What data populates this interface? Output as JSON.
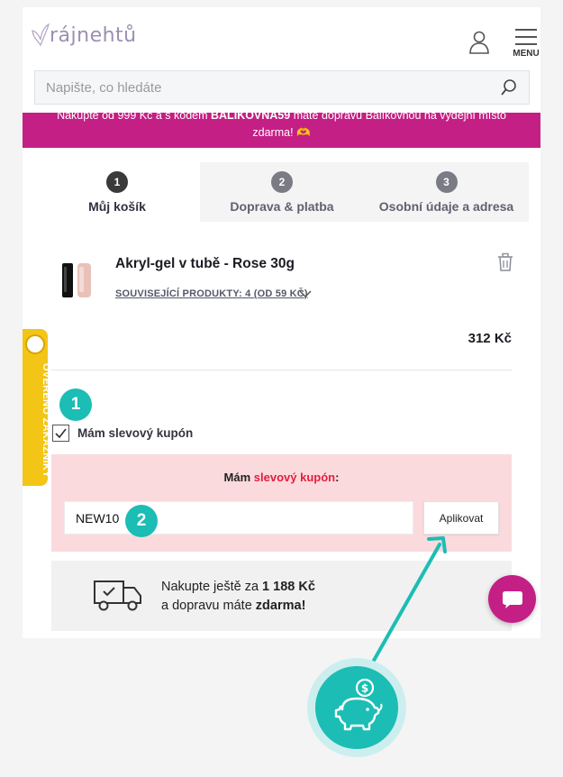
{
  "header": {
    "logo_text": "rájnehtů",
    "menu_label": "MENU"
  },
  "search": {
    "placeholder": "Napište, co hledáte"
  },
  "promo": {
    "text_part1": "Nakupte od 999 Kč a s kódem ",
    "code": "BALIKOVNA59",
    "text_part2": " máte dopravu Balíkovnou na výdejní místo",
    "text_line2": "zdarma! 🫶"
  },
  "steps": [
    {
      "number": "1",
      "label": "Můj košík",
      "active": true
    },
    {
      "number": "2",
      "label": "Doprava & platba",
      "active": false
    },
    {
      "number": "3",
      "label": "Osobní údaje a adresa",
      "active": false
    }
  ],
  "cart_item": {
    "title": "Akryl-gel v tubě - Rose 30g",
    "related_link": "SOUVISEJÍCÍ PRODUKTY: 4 (OD 59 KČ)",
    "price": "312 Kč"
  },
  "verified_badge": {
    "text": "OVĚŘENO ZÁKAZNÍKY"
  },
  "markers": [
    "1",
    "2"
  ],
  "coupon": {
    "checkbox_label": "Mám slevový kupón",
    "checked": true,
    "box_title_part1": "Mám ",
    "box_title_highlight": "slevový kupón",
    "box_title_part2": ":",
    "input_value": "NEW10",
    "apply_label": "Aplikovat"
  },
  "shipping": {
    "line1_part1": "Nakupte ještě za ",
    "line1_amount": "1 188 Kč",
    "line2_part1": "a dopravu máte ",
    "line2_bold": "zdarma!"
  },
  "colors": {
    "brand_magenta": "#c41f85",
    "teal": "#1bbdb4",
    "coupon_bg": "#fbdadd",
    "coupon_highlight": "#e41e3c",
    "badge_yellow": "#f2c517"
  },
  "icons": [
    "user-icon",
    "menu-icon",
    "search-icon",
    "trash-icon",
    "chevron-down-icon",
    "check-icon",
    "truck-icon",
    "chat-icon",
    "piggy-bank-icon",
    "arrow-icon"
  ]
}
